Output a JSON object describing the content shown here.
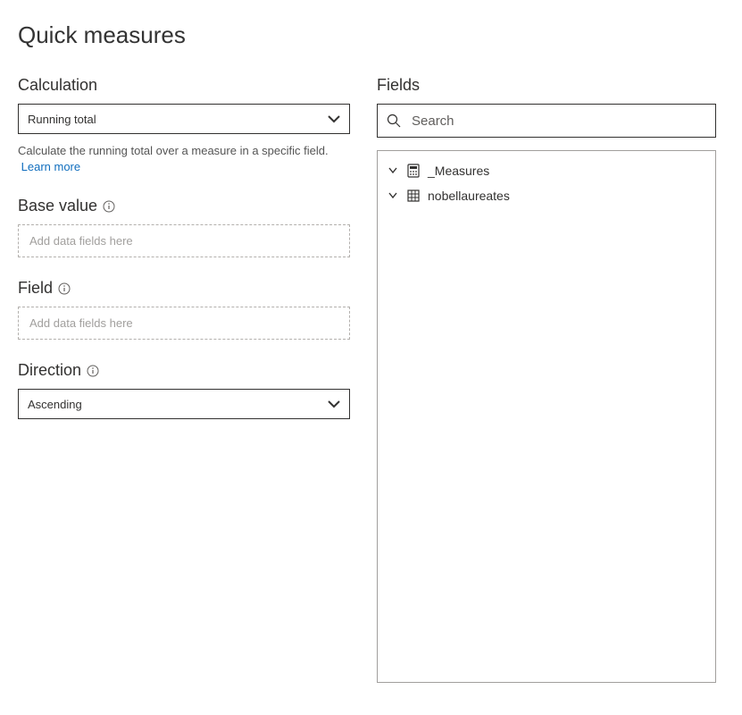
{
  "title": "Quick measures",
  "left": {
    "calculation": {
      "label": "Calculation",
      "selected": "Running total",
      "help": "Calculate the running total over a measure in a specific field.",
      "learn_more": "Learn more"
    },
    "base_value": {
      "label": "Base value",
      "placeholder": "Add data fields here"
    },
    "field": {
      "label": "Field",
      "placeholder": "Add data fields here"
    },
    "direction": {
      "label": "Direction",
      "selected": "Ascending"
    }
  },
  "right": {
    "fields_label": "Fields",
    "search_placeholder": "Search",
    "tables": [
      {
        "name": "_Measures",
        "icon": "calculator"
      },
      {
        "name": "nobellaureates",
        "icon": "table"
      }
    ]
  }
}
